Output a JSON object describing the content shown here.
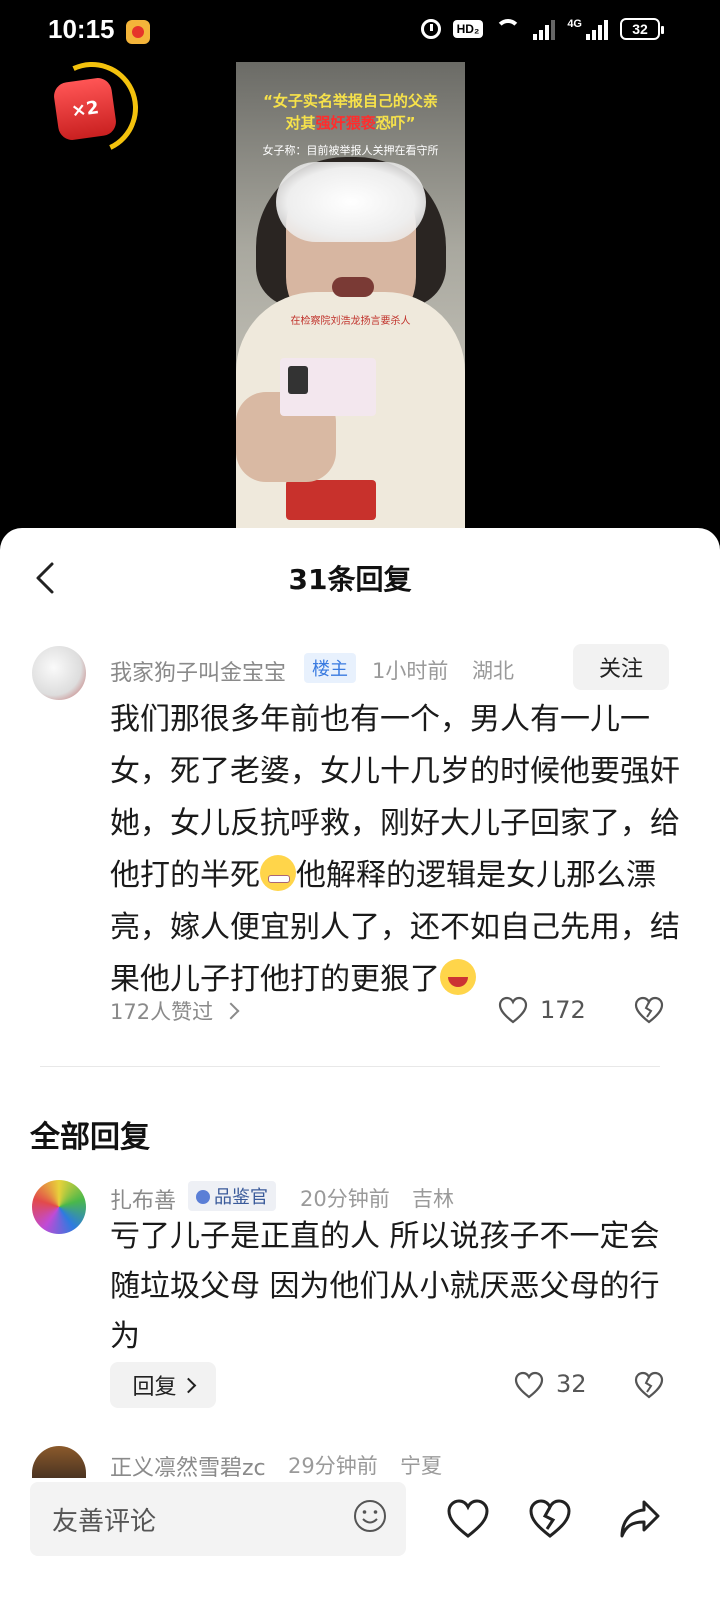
{
  "status": {
    "time": "10:15",
    "hd": "HD₂",
    "net": "4G",
    "battery": "32"
  },
  "redpacket": {
    "label": "×2"
  },
  "video": {
    "title_line1": "“女子实名举报自己的父亲",
    "title_line2_pre": "对其",
    "title_line2_highlight": "强奸猥亵",
    "title_line2_post": "恐吓”",
    "subtitle": "女子称：目前被举报人关押在看守所",
    "caption": "在检察院刘浩龙扬言要杀人"
  },
  "sheet": {
    "title": "31条回复"
  },
  "main_comment": {
    "username": "我家狗子叫金宝宝",
    "tag": "楼主",
    "time": "1小时前",
    "location": "湖北",
    "follow_label": "关注",
    "text_part1": "我们那很多年前也有一个，男人有一儿一女，死了老婆，女儿十几岁的时候他要强奸她，女儿反抗呼救，刚好大儿子回家了，给他打的半死",
    "text_part2": "他解释的逻辑是女儿那么漂亮，嫁人便宜别人了，还不如自己先用，结果他儿子打他打的更狠了",
    "emoji1": "grimace-emoji",
    "emoji2": "laughing-crying-emoji",
    "likes_summary": "172人赞过",
    "like_count": "172"
  },
  "section_title": "全部回复",
  "replies": [
    {
      "username": "扎布善",
      "tag": "品鉴官",
      "time": "20分钟前",
      "location": "吉林",
      "text": "亏了儿子是正直的人 所以说孩子不一定会随垃圾父母 因为他们从小就厌恶父母的行为",
      "reply_label": "回复",
      "like_count": "32"
    },
    {
      "username": "正义凛然雪碧zc",
      "time": "29分钟前",
      "location": "宁夏"
    }
  ],
  "bottom": {
    "input_placeholder": "友善评论"
  },
  "colors": {
    "op_tag_bg": "#e8f1fd",
    "op_tag_text": "#3a7be0",
    "highlight_red": "#ff2d2d",
    "title_yellow": "#f7e24a"
  }
}
